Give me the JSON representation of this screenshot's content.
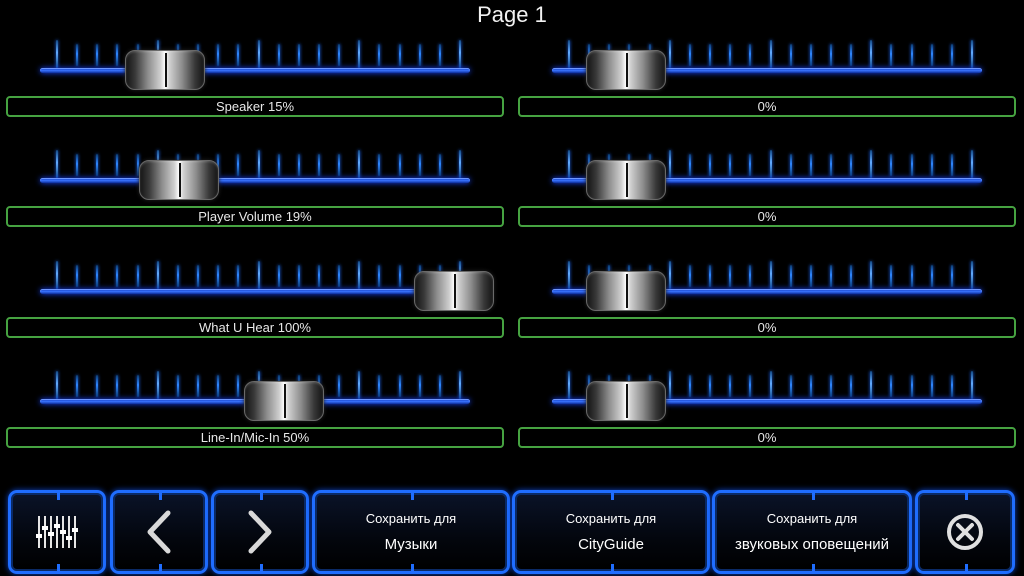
{
  "page": {
    "title": "Page 1"
  },
  "sliders_left": [
    {
      "label": "Speaker 15%",
      "value_percent": 15
    },
    {
      "label": "Player Volume 19%",
      "value_percent": 19
    },
    {
      "label": "What U Hear 100%",
      "value_percent": 100
    },
    {
      "label": "Line-In/Mic-In 50%",
      "value_percent": 50
    }
  ],
  "sliders_right": [
    {
      "label": "0%",
      "value_percent": 0
    },
    {
      "label": "0%",
      "value_percent": 0
    },
    {
      "label": "0%",
      "value_percent": 0
    },
    {
      "label": "0%",
      "value_percent": 0
    }
  ],
  "toolbar": {
    "mixer_icon": "mixer-faders-icon",
    "prev_icon": "chevron-left-icon",
    "next_icon": "chevron-right-icon",
    "close_icon": "close-circle-icon",
    "save_music": {
      "line1": "Сохранить для",
      "line2": "Музыки"
    },
    "save_cityguide": {
      "line1": "Сохранить для",
      "line2": "CityGuide"
    },
    "save_alerts": {
      "line1": "Сохранить для",
      "line2": "звуковых оповещений"
    }
  },
  "colors": {
    "accent_blue": "#1f6dff",
    "label_border_green": "#46a341",
    "background": "#000000"
  }
}
